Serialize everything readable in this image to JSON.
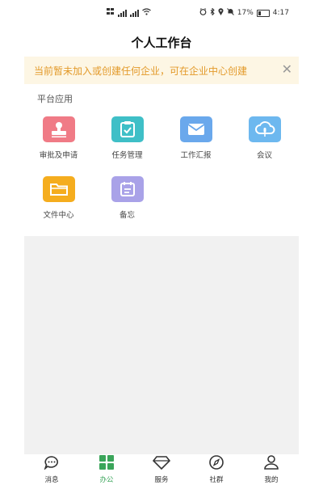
{
  "status_bar": {
    "battery_percent": "17%",
    "time": "4:17"
  },
  "header": {
    "title": "个人工作台"
  },
  "notice": {
    "text": "当前暂未加入或创建任何企业，可在企业中心创建",
    "close_icon": "close-icon"
  },
  "section": {
    "title": "平台应用"
  },
  "apps": [
    {
      "label": "审批及申请",
      "color": "#f07b86",
      "icon": "stamp-icon"
    },
    {
      "label": "任务管理",
      "color": "#3fbfc7",
      "icon": "clipboard-check-icon"
    },
    {
      "label": "工作汇报",
      "color": "#6aa8ec",
      "icon": "envelope-icon"
    },
    {
      "label": "会议",
      "color": "#6db8ef",
      "icon": "cloud-mic-icon"
    },
    {
      "label": "文件中心",
      "color": "#f5ad1e",
      "icon": "folder-icon"
    },
    {
      "label": "备忘",
      "color": "#a9a2e8",
      "icon": "calendar-icon"
    }
  ],
  "tabbar": {
    "items": [
      {
        "label": "消息",
        "icon": "chat-icon"
      },
      {
        "label": "办公",
        "icon": "grid-icon",
        "active": true
      },
      {
        "label": "服务",
        "icon": "diamond-icon"
      },
      {
        "label": "社群",
        "icon": "compass-icon"
      },
      {
        "label": "我的",
        "icon": "person-icon"
      }
    ],
    "active_color": "#3aa55a"
  }
}
